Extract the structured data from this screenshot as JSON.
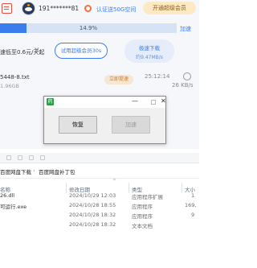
{
  "header": {
    "username": "191*******81",
    "auth_link": "认证送50G空间",
    "super_member_button": "开通超级会员"
  },
  "download_progress": {
    "percent_text": "14.9%",
    "fill_fraction": 0.149,
    "side_link": "加速"
  },
  "promo": {
    "text": "速低至0.6元/天起",
    "trial_button": "试用超级会员30s",
    "speed_button": "极速下载",
    "speed_button_sub": "约9.47MB/s"
  },
  "task": {
    "file_name": "5448-8.txt",
    "file_size": "1.96GB",
    "tag_button": "立即提速",
    "time": "25:12:14",
    "speed": "26 KB/s"
  },
  "dialog": {
    "app_icon_text": "药",
    "restore_button": "恢复",
    "accelerate_button": "加速",
    "minimize_glyph": "—",
    "close_glyph": "✕"
  },
  "explorer": {
    "breadcrumb": [
      "百度网盘下载",
      "百度网盘补丁包"
    ],
    "breadcrumb_prefix": "百度网盘下载",
    "columns": {
      "name": "名称",
      "modified": "修改日期",
      "type": "类型",
      "size": "大小"
    },
    "rows": [
      {
        "name": "26.dll",
        "modified": "2024/10/29 12:03",
        "type": "应用程序扩展",
        "size": "1"
      },
      {
        "name": "可运行.exe",
        "modified": "2024/10/28 18:55",
        "type": "应用程序",
        "size": "169,"
      },
      {
        "name": "",
        "modified": "2024/10/28 18:32",
        "type": "应用程序",
        "size": "9"
      },
      {
        "name": "",
        "modified": "2024/10/28 18:32",
        "type": "文本文档",
        "size": ""
      }
    ]
  },
  "colors": {
    "accent_blue": "#3b7cee",
    "dialog_bg": "#f0f0f0",
    "gold": "#fde9c4"
  }
}
